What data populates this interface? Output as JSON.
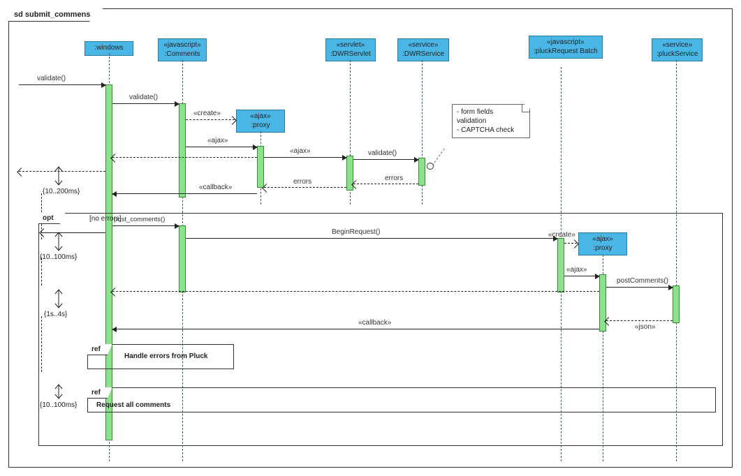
{
  "frame_title": "sd submit_commens",
  "participants": {
    "windows": {
      "stereotype": "",
      "name": ":windows"
    },
    "comments": {
      "stereotype": "«javascript»",
      "name": ":Comments"
    },
    "proxy1": {
      "stereotype": "«ajax»",
      "name": ":proxy"
    },
    "servlet": {
      "stereotype": "«servlet»",
      "name": ":DWRServlet"
    },
    "dwrsvc": {
      "stereotype": "«service»",
      "name": ":DWRService"
    },
    "batch": {
      "stereotype": "«javascript»",
      "name": ":pluckRequest Batch"
    },
    "proxy2": {
      "stereotype": "«ajax»",
      "name": ":proxy"
    },
    "plucksvc": {
      "stereotype": "«service»",
      "name": ":pluckService"
    }
  },
  "messages": {
    "m_validate_in": "validate()",
    "m_validate_js": "validate()",
    "m_create1": "«create»",
    "m_ajax1": "«ajax»",
    "m_ajax2": "«ajax»",
    "m_validate_srv": "validate()",
    "m_errors1": "errors",
    "m_errors2": "errors",
    "m_callback1": "«callback»",
    "m_post": "post_comments()",
    "m_begin": "BeginRequest()",
    "m_create2": "«create»",
    "m_ajax3": "«ajax»",
    "m_postc": "postComments()",
    "m_json": "«json»",
    "m_callback2": "«callback»"
  },
  "note": {
    "line1": "- form fields",
    "line2": "validation",
    "line3": "- CAPTCHA check"
  },
  "constraints": {
    "c1": "{10..200ms}",
    "c2": "{10..100ms}",
    "c3": "{1s..4s}",
    "c4": "{10..100ms}"
  },
  "fragments": {
    "opt": "opt",
    "opt_guard": "[no errors]",
    "ref1": "ref",
    "ref1_text": "Handle errors from Pluck",
    "ref2": "ref",
    "ref2_text": "Request all comments"
  }
}
